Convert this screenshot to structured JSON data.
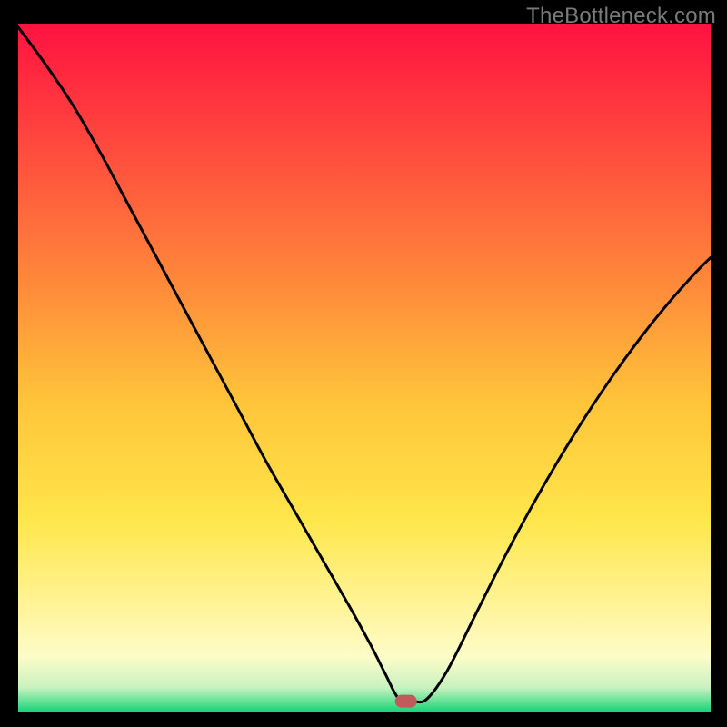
{
  "watermark": "TheBottleneck.com",
  "chart_data": {
    "type": "line",
    "title": "",
    "xlabel": "",
    "ylabel": "",
    "xlim": [
      0,
      100
    ],
    "ylim": [
      0,
      100
    ],
    "grid": false,
    "legend": false,
    "minimum_marker": {
      "x": 56,
      "y": 1.5,
      "color": "#c15a5a"
    },
    "background": {
      "type": "vertical-gradient",
      "stops": [
        {
          "pct": 0,
          "color": "#ff1240"
        },
        {
          "pct": 18,
          "color": "#ff4a3e"
        },
        {
          "pct": 38,
          "color": "#ff8a3a"
        },
        {
          "pct": 55,
          "color": "#ffc43a"
        },
        {
          "pct": 72,
          "color": "#ffe64a"
        },
        {
          "pct": 85,
          "color": "#fff49a"
        },
        {
          "pct": 92,
          "color": "#fdfcc8"
        },
        {
          "pct": 96.5,
          "color": "#c9f2c0"
        },
        {
          "pct": 98,
          "color": "#7ee6a0"
        },
        {
          "pct": 100,
          "color": "#18d37a"
        }
      ]
    },
    "series": [
      {
        "name": "bottleneck-curve",
        "color": "#000000",
        "x": [
          0,
          4,
          8,
          12,
          16,
          20,
          24,
          28,
          32,
          36,
          40,
          44,
          48,
          51,
          53,
          55,
          57,
          59,
          62,
          66,
          70,
          74,
          78,
          82,
          86,
          90,
          94,
          98,
          100
        ],
        "y": [
          99.5,
          94,
          88,
          81,
          73.5,
          66,
          58.5,
          51,
          43.5,
          36,
          29,
          22,
          15,
          9.5,
          5.5,
          1.8,
          1.5,
          1.8,
          6,
          14,
          22,
          29.5,
          36.5,
          43,
          49,
          54.5,
          59.5,
          64,
          66
        ]
      }
    ]
  }
}
